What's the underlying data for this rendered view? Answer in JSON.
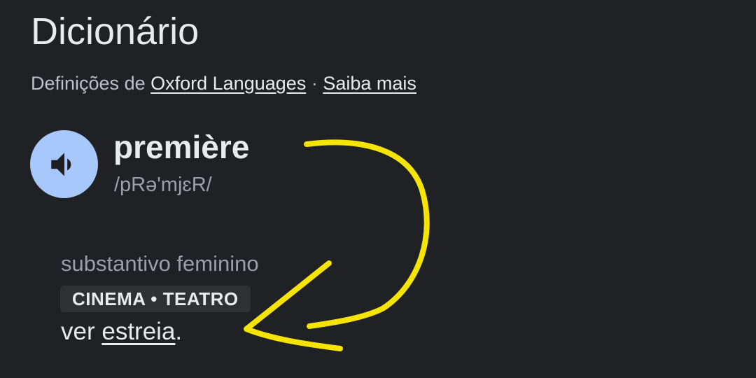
{
  "header": {
    "title": "Dicionário"
  },
  "source": {
    "prefix": "Definições de",
    "provider_link": "Oxford Languages",
    "separator": "·",
    "learn_more_link": "Saiba mais"
  },
  "entry": {
    "speaker_icon": "volume-icon",
    "word": "première",
    "phonetic": "/pRə'mjɛR/",
    "part_of_speech": "substantivo feminino",
    "domain_label": "CINEMA • TEATRO",
    "definition_prefix": "ver",
    "definition_link": "estreia",
    "definition_suffix": "."
  },
  "colors": {
    "background": "#202124",
    "speaker_button": "#a8c7fa",
    "annotation_arrow": "#f5e400"
  },
  "annotation": {
    "type": "hand-drawn-arrow"
  }
}
